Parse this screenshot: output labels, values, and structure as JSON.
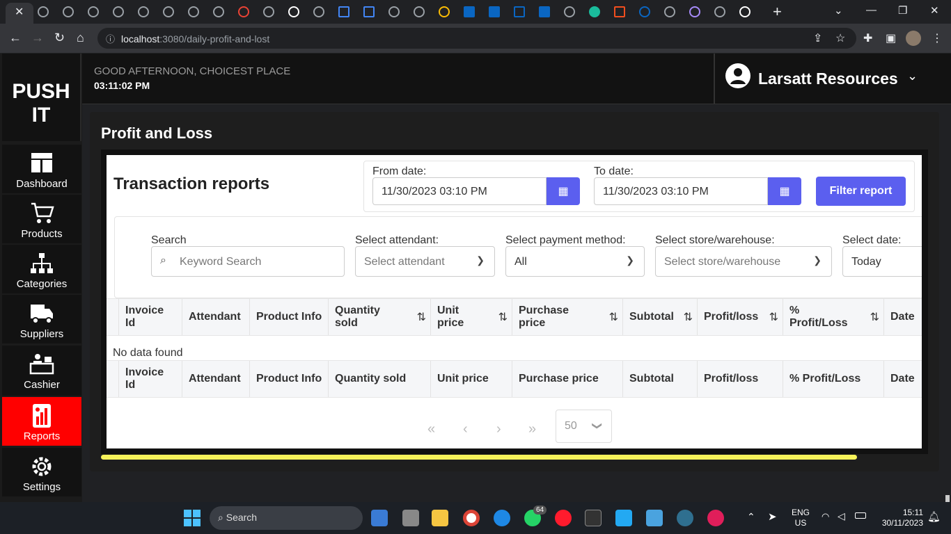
{
  "browser": {
    "url_host": "localhost",
    "url_path": ":3080/daily-profit-and-lost",
    "close_glyph": "✕",
    "new_tab_glyph": "+"
  },
  "sidebar": {
    "brand_line1": "PUSH",
    "brand_line2": "IT",
    "items": [
      {
        "label": "Dashboard",
        "icon": "dashboard-icon"
      },
      {
        "label": "Products",
        "icon": "cart-icon"
      },
      {
        "label": "Categories",
        "icon": "hierarchy-icon"
      },
      {
        "label": "Suppliers",
        "icon": "truck-icon"
      },
      {
        "label": "Cashier",
        "icon": "cashier-icon"
      },
      {
        "label": "Reports",
        "icon": "reports-icon",
        "active": true
      },
      {
        "label": "Settings",
        "icon": "gear-icon"
      }
    ]
  },
  "header": {
    "greeting": "GOOD AFTERNOON, CHOICEST PLACE",
    "time": "03:11:02 PM",
    "user_name": "Larsatt Resources"
  },
  "page": {
    "title": "Profit and Loss",
    "card_title": "Transaction reports",
    "from_label": "From date:",
    "from_value": "11/30/2023 03:10 PM",
    "to_label": "To date:",
    "to_value": "11/30/2023 03:10 PM",
    "filter_button": "Filter report"
  },
  "filters": {
    "search_label": "Search",
    "search_placeholder": "Keyword Search",
    "attendant_label": "Select attendant:",
    "attendant_value": "Select attendant",
    "payment_label": "Select payment method:",
    "payment_value": "All",
    "store_label": "Select store/warehouse:",
    "store_value": "Select store/warehouse",
    "date_label": "Select date:",
    "date_value": "Today"
  },
  "table": {
    "header_top": [
      "Invoice Id",
      "Attendant",
      "Product Info",
      "Quantity sold",
      "Unit price",
      "Purchase price",
      "Subtotal",
      "Profit/loss",
      "% Profit/Loss",
      "Date"
    ],
    "header_bottom": [
      "Invoice Id",
      "Attendant",
      "Product Info",
      "Quantity sold",
      "Unit price",
      "Purchase price",
      "Subtotal",
      "Profit/loss",
      "% Profit/Loss",
      "Date"
    ],
    "empty_message": "No data found"
  },
  "pagination": {
    "first": "«",
    "prev": "‹",
    "next": "›",
    "last": "»",
    "page_size": "50"
  },
  "taskbar": {
    "search_label": "Search",
    "lang_top": "ENG",
    "lang_bottom": "US",
    "time": "15:11",
    "date": "30/11/2023",
    "whatsapp_badge": "64"
  },
  "colors": {
    "accent": "#5b5fef",
    "active_nav": "#ff0000",
    "progress_bar": "#f7f35a"
  }
}
